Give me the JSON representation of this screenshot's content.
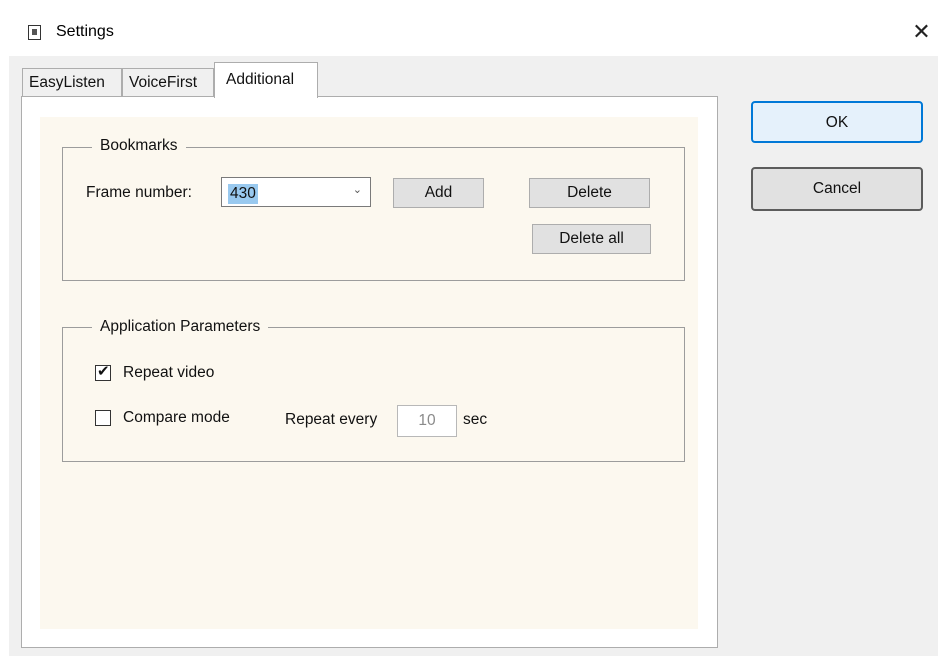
{
  "window": {
    "title": "Settings",
    "close_symbol": "✕"
  },
  "tabs": [
    {
      "label": "EasyListen",
      "active": false
    },
    {
      "label": "VoiceFirst",
      "active": false
    },
    {
      "label": "Additional",
      "active": true
    }
  ],
  "bookmarks": {
    "group_label": "Bookmarks",
    "frame_label": "Frame number:",
    "frame_value": "430",
    "add_label": "Add",
    "delete_label": "Delete",
    "delete_all_label": "Delete all"
  },
  "app_params": {
    "group_label": "Application Parameters",
    "repeat_video_label": "Repeat video",
    "repeat_video_checked": true,
    "compare_mode_label": "Compare mode",
    "compare_mode_checked": false,
    "repeat_every_label": "Repeat every",
    "repeat_every_value": "10",
    "repeat_every_unit": "sec"
  },
  "dialog_buttons": {
    "ok_label": "OK",
    "cancel_label": "Cancel"
  },
  "icons": {
    "title": "settings-doc-icon",
    "close": "close-icon",
    "chevron": "chevron-down-icon",
    "check": "checkmark-icon"
  },
  "colors": {
    "accent": "#0078d7",
    "selection": "#99c9ef",
    "panel_bg": "#fcf8ef"
  }
}
